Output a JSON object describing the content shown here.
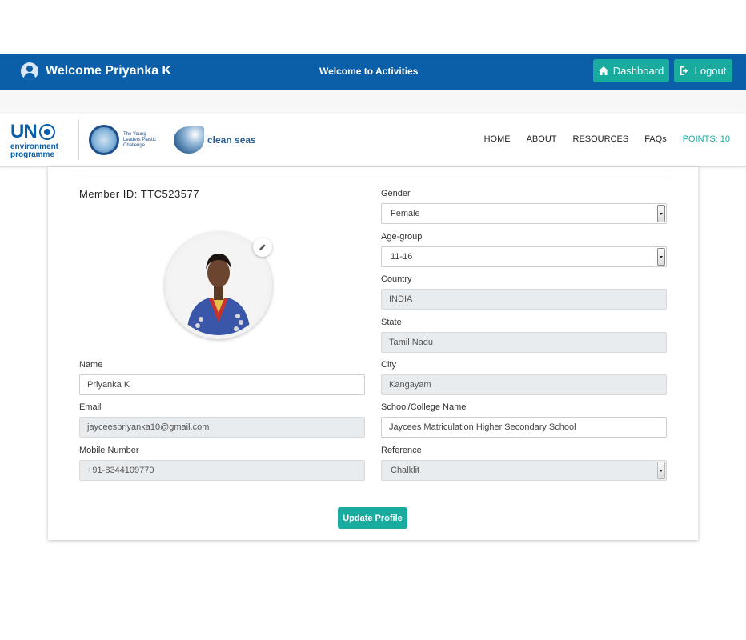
{
  "header": {
    "welcome": "Welcome Priyanka K",
    "center_text": "Welcome to Activities",
    "dashboard_label": "Dashboard",
    "logout_label": "Logout",
    "dashboard_icon": "home-icon",
    "logout_icon": "sign-out-icon"
  },
  "logos": {
    "un_text": "UN",
    "un_sub": "environment programme",
    "tide_text": "The Young Leaders Plastic Challenge",
    "seas_text": "clean seas"
  },
  "nav": {
    "home": "HOME",
    "about": "ABOUT",
    "resources": "RESOURCES",
    "faqs": "FAQs",
    "points": "POINTS: 10"
  },
  "profile": {
    "member_id": "Member ID: TTC523577",
    "edit_icon": "pencil-icon",
    "name_label": "Name",
    "name_value": "Priyanka K",
    "email_label": "Email",
    "email_value": "jayceespriyanka10@gmail.com",
    "mobile_label": "Mobile Number",
    "mobile_value": "+91-8344109770",
    "gender_label": "Gender",
    "gender_value": "Female",
    "age_label": "Age-group",
    "age_value": "11-16",
    "country_label": "Country",
    "country_value": "INDIA",
    "state_label": "State",
    "state_value": "Tamil Nadu",
    "city_label": "City",
    "city_value": "Kangayam",
    "school_label": "School/College Name",
    "school_value": "Jaycees Matriculation Higher Secondary School",
    "reference_label": "Reference",
    "reference_value": "Chalklit",
    "update_label": "Update Profile"
  },
  "colors": {
    "header_bg": "#0b5ea8",
    "accent": "#1aab9f"
  }
}
